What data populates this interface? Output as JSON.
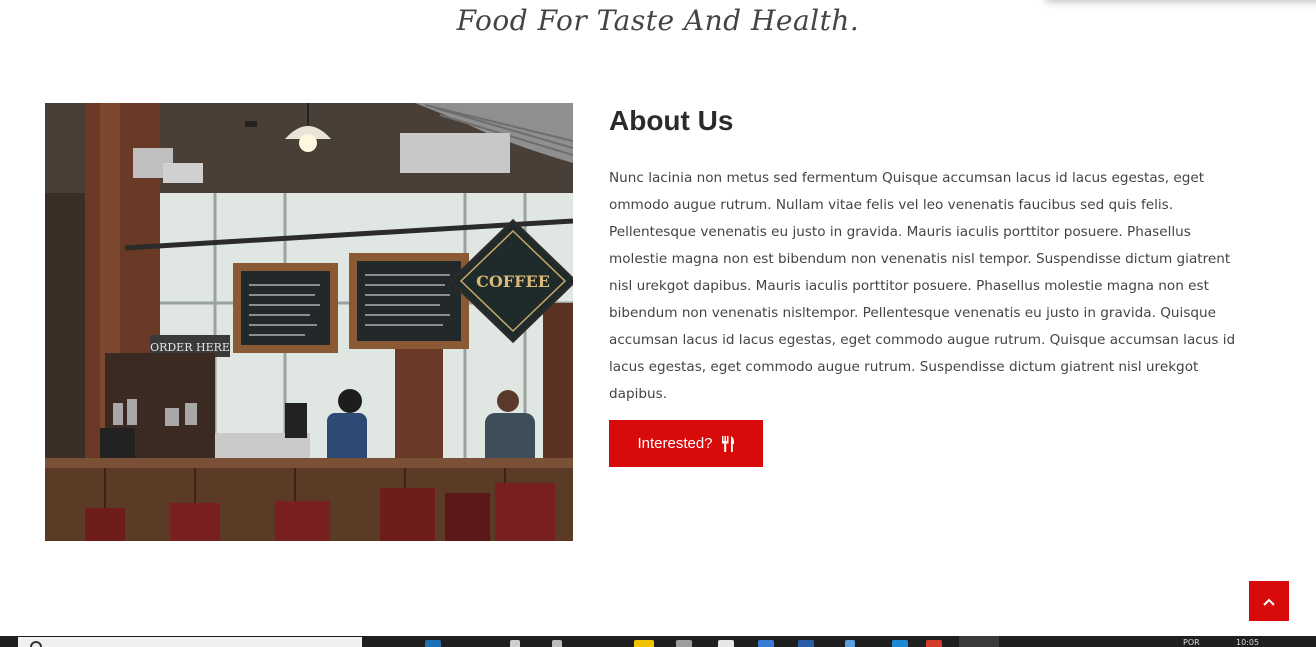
{
  "hero": {
    "tagline": "Food For Taste And Health."
  },
  "about": {
    "title": "About Us",
    "body": "Nunc lacinia non metus sed fermentum Quisque accumsan lacus id lacus egestas, eget ommodo augue rutrum. Nullam vitae felis vel leo venenatis faucibus sed quis felis. Pellentesque venenatis eu justo in gravida. Mauris iaculis porttitor posuere. Phasellus molestie magna non est bibendum non venenatis nisl tempor. Suspendisse dictum giatrent nisl urekgot dapibus. Mauris iaculis porttitor posuere. Phasellus molestie magna non est bibendum non venenatis nisltempor. Pellentesque venenatis eu justo in gravida. Quisque accumsan lacus id lacus egestas, eget commodo augue rutrum. Quisque accumsan lacus id lacus egestas, eget commodo augue rutrum. Suspendisse dictum giatrent nisl urekgot dapibus.",
    "button_label": "Interested?",
    "button_icon": "cutlery-icon",
    "image_alt": "cafe-interior-photo"
  },
  "cafe_signs": {
    "coffee": "COFFEE",
    "order": "ORDER HERE"
  },
  "scroll_top": {
    "icon": "chevron-up-icon"
  },
  "taskbar": {
    "lang": "POR",
    "time": "10:05"
  },
  "colors": {
    "accent": "#d90a0a",
    "heading": "#2b2b2b",
    "body_text": "#444444",
    "taskbar": "#1f1f1f"
  }
}
